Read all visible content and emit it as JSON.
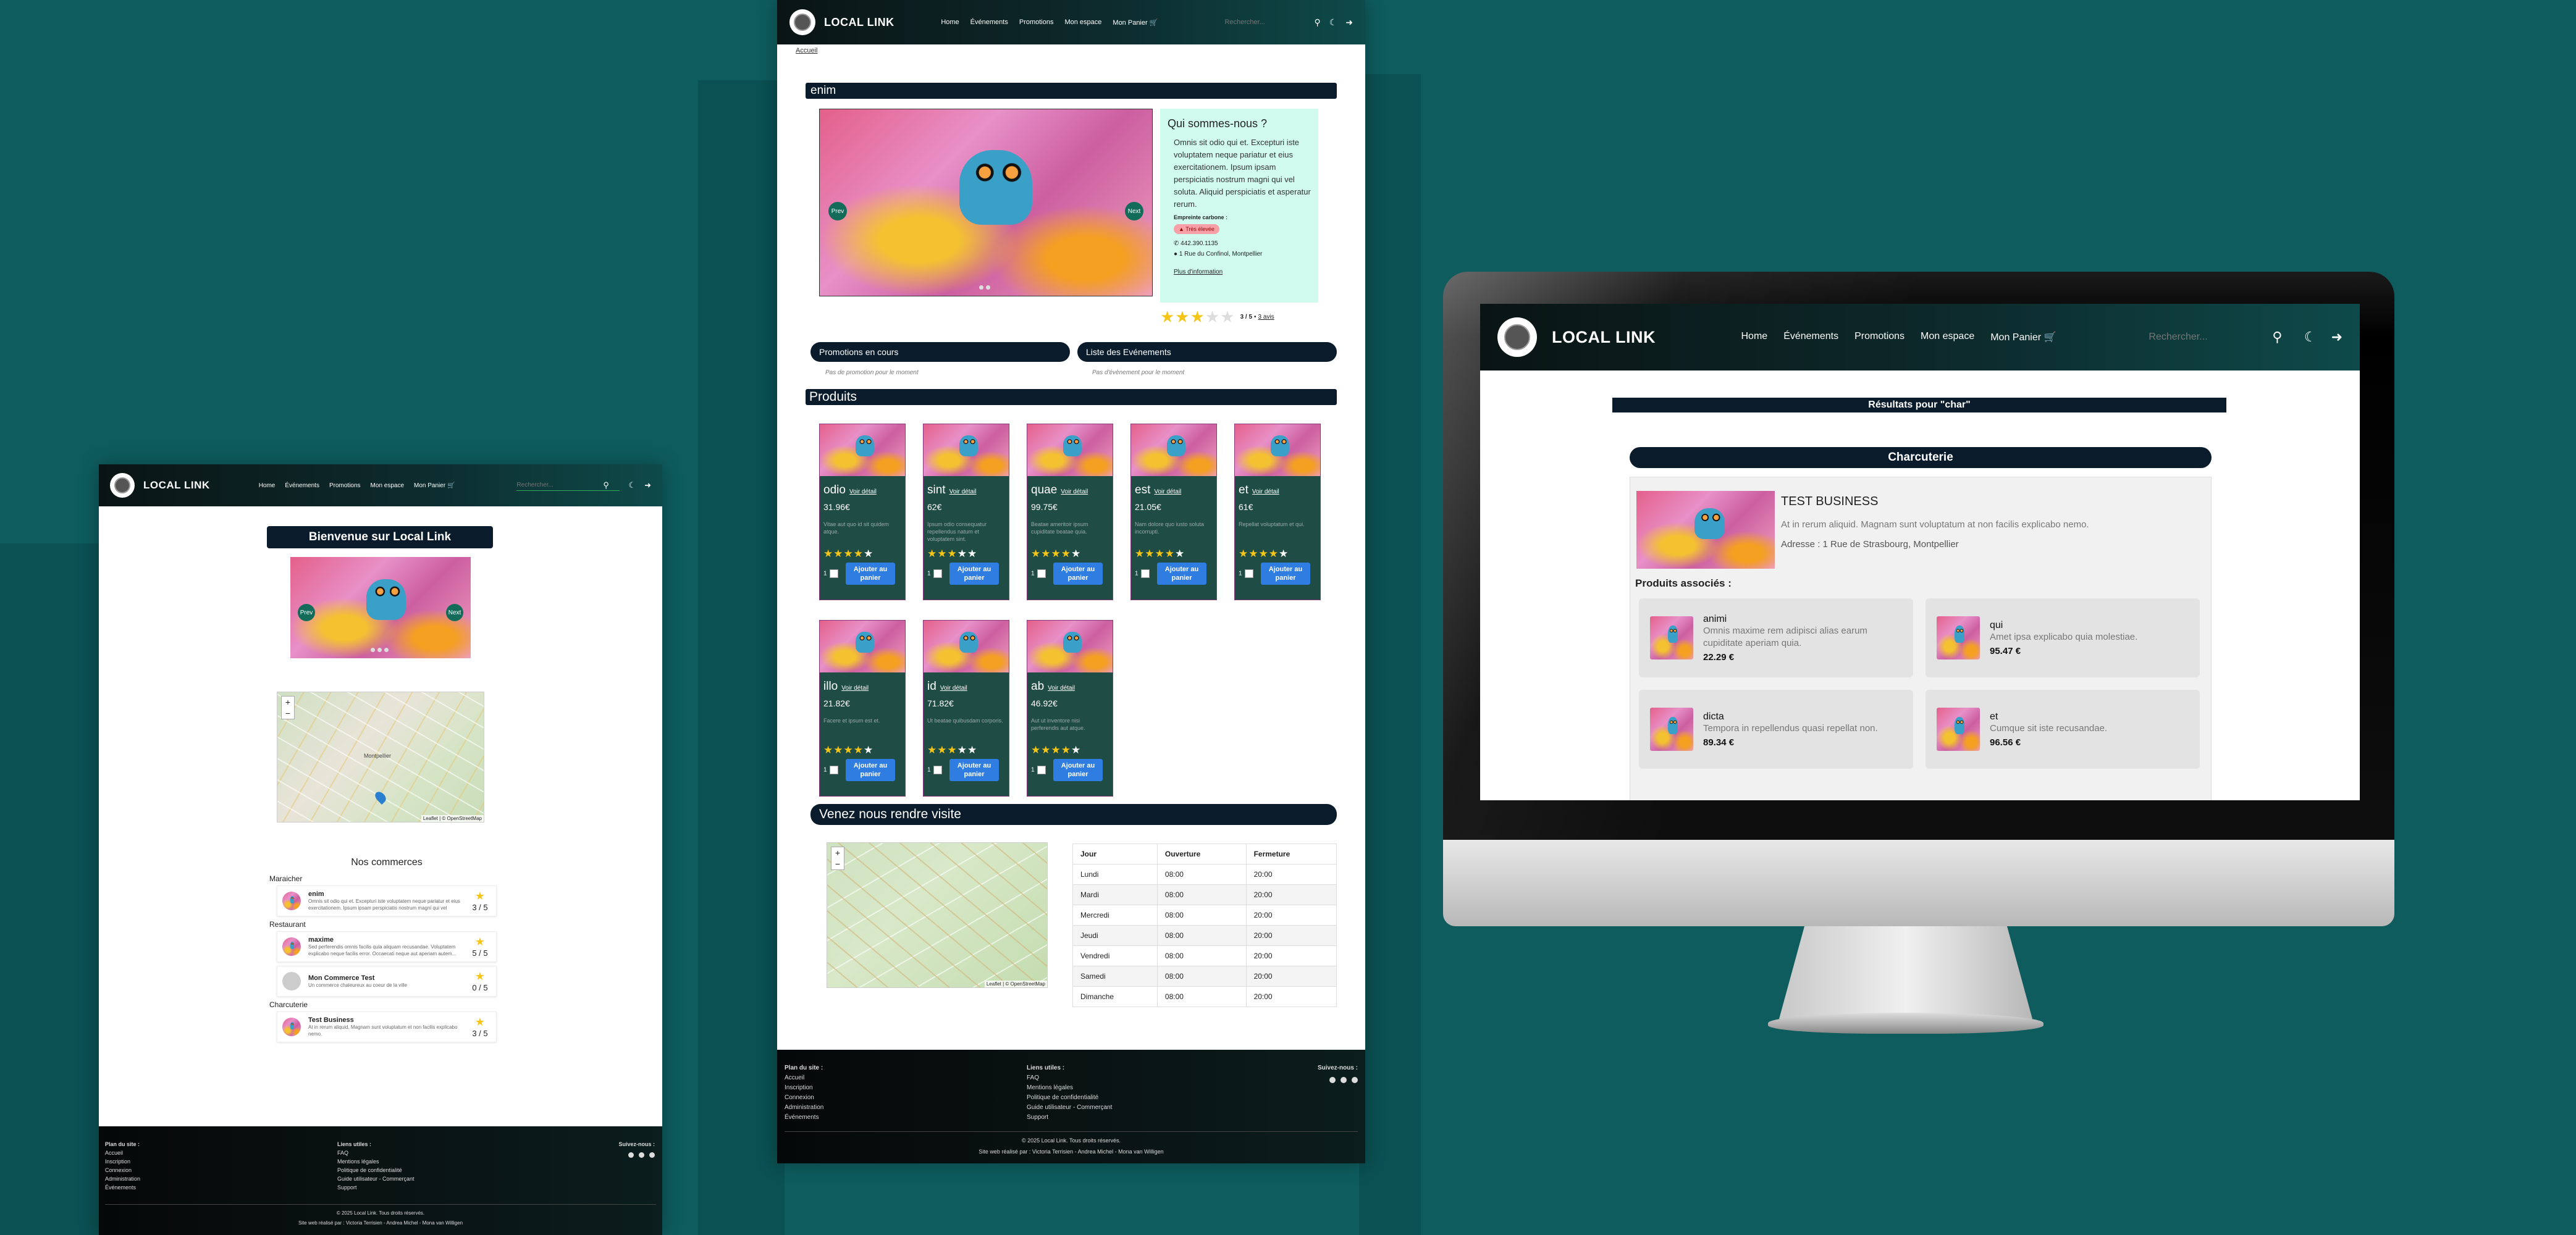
{
  "brand": "LOCAL LINK",
  "nav": [
    "Home",
    "Événements",
    "Promotions",
    "Mon espace",
    "Mon Panier"
  ],
  "search_placeholder": "Rechercher...",
  "carousel": {
    "prev": "Prev",
    "next": "Next"
  },
  "page1": {
    "welcome": "Bienvenue sur Local Link",
    "map_attrib": "Leaflet | © OpenStreetMap",
    "map_city": "Montpellier",
    "commerces_title": "Nos commerces",
    "categories": [
      {
        "name": "Maraicher",
        "items": [
          {
            "name": "enim",
            "desc": "Omnis sit odio qui et. Excepturi iste voluptatem neque pariatur et eius exercitationem. Ipsum ipsam perspiciatis nostrum magni qui vel",
            "rating": "3 / 5"
          }
        ]
      },
      {
        "name": "Restaurant",
        "items": [
          {
            "name": "maxime",
            "desc": "Sed perferendis omnis facilis quia aliquam recusandae. Voluptatem explicabo neque facilis error. Occaecati neque aut aperiam autem...",
            "rating": "5 / 5"
          },
          {
            "name": "Mon Commerce Test",
            "desc": "Un commerce chaleureux au coeur de la ville",
            "rating": "0 / 5"
          }
        ]
      },
      {
        "name": "Charcuterie",
        "items": [
          {
            "name": "Test Business",
            "desc": "At in rerum aliquid. Magnam sunt voluptatum et non facilis explicabo nemo.",
            "rating": "3 / 5"
          }
        ]
      }
    ]
  },
  "footer": {
    "plan_title": "Plan du site :",
    "plan_links": [
      "Accueil",
      "Inscription",
      "Connexion",
      "Administration",
      "Événements"
    ],
    "util_title": "Liens utiles :",
    "util_links": [
      "FAQ",
      "Mentions légales",
      "Politique de confidentialité",
      "Guide utilisateur - Commerçant",
      "Support"
    ],
    "follow_title": "Suivez-nous :",
    "copyright": "© 2025 Local Link. Tous droits réservés.",
    "credits": "Site web réalisé par : Victoria Terrisien - Andrea Michel - Mona van Willigen"
  },
  "page2": {
    "breadcrumb": "Accueil",
    "title": "enim",
    "about_title": "Qui sommes-nous ?",
    "about_text": "Omnis sit odio qui et. Excepturi iste voluptatem neque pariatur et eius exercitationem. Ipsum ipsam perspiciatis nostrum magni qui vel soluta. Aliquid perspiciatis et asperatur rerum.",
    "carbon_label": "Empreinte carbone :",
    "carbon_badge": "Très élevée",
    "phone": "442.390.1135",
    "address": "1 Rue du Confinol, Montpellier",
    "more_info": "Plus d'information",
    "rating_text": "3 / 5",
    "reviews": "3 avis",
    "promotions_label": "Promotions en cours",
    "promotions_empty": "Pas de promotion pour le moment",
    "events_label": "Liste des Evénements",
    "events_empty": "Pas d'évènement pour le moment",
    "products_title": "Produits",
    "detail_link": "Voir détail",
    "add_label": "Ajouter au panier",
    "products": [
      {
        "name": "odio",
        "price": "31.96€",
        "desc": "Vitae aut quo id sit quidem atque.",
        "stars": 4
      },
      {
        "name": "sint",
        "price": "62€",
        "desc": "Ipsum odio consequatur repellendus natum et voluptatem sint.",
        "stars": 3
      },
      {
        "name": "quae",
        "price": "99.75€",
        "desc": "Beatae ameritoir ipsum cupiditate beatae quia.",
        "stars": 4
      },
      {
        "name": "est",
        "price": "21.05€",
        "desc": "Nam dolore quo iusto soluta incorrupti.",
        "stars": 4
      },
      {
        "name": "et",
        "price": "61€",
        "desc": "Repellat voluptatum et qui.",
        "stars": 4
      },
      {
        "name": "illo",
        "price": "21.82€",
        "desc": "Facere et ipsum est et.",
        "stars": 4
      },
      {
        "name": "id",
        "price": "71.82€",
        "desc": "Ut beatae quibusdam corporis.",
        "stars": 3
      },
      {
        "name": "ab",
        "price": "46.92€",
        "desc": "Aut ut inventore nisi perferendis aut atque.",
        "stars": 4
      }
    ],
    "visit_title": "Venez nous rendre visite",
    "hours_headers": [
      "Jour",
      "Ouverture",
      "Fermeture"
    ],
    "hours": [
      [
        "Lundi",
        "08:00",
        "20:00"
      ],
      [
        "Mardi",
        "08:00",
        "20:00"
      ],
      [
        "Mercredi",
        "08:00",
        "20:00"
      ],
      [
        "Jeudi",
        "08:00",
        "20:00"
      ],
      [
        "Vendredi",
        "08:00",
        "20:00"
      ],
      [
        "Samedi",
        "08:00",
        "20:00"
      ],
      [
        "Dimanche",
        "08:00",
        "20:00"
      ]
    ]
  },
  "screen": {
    "results_title": "Résultats pour \"char\"",
    "category": "Charcuterie",
    "business_name": "TEST BUSINESS",
    "business_desc": "At in rerum aliquid. Magnam sunt voluptatum at non facilis explicabo nemo.",
    "business_address": "Adresse : 1 Rue de Strasbourg, Montpellier",
    "assoc_title": "Produits associés :",
    "assoc": [
      {
        "name": "animi",
        "desc": "Omnis maxime rem adipisci alias earum cupiditate aperiam quia.",
        "price": "22.29 €"
      },
      {
        "name": "qui",
        "desc": "Amet ipsa explicabo quia molestiae.",
        "price": "95.47 €"
      },
      {
        "name": "dicta",
        "desc": "Tempora in repellendus quasi repellat non.",
        "price": "89.34 €"
      },
      {
        "name": "et",
        "desc": "Cumque sit iste recusandae.",
        "price": "96.56 €"
      }
    ]
  },
  "colors": {
    "background": "#0e5c5e",
    "navy": "#0a1c2c",
    "mint": "#d0fbee",
    "button": "#2f7de0",
    "card": "#1f4c44"
  }
}
